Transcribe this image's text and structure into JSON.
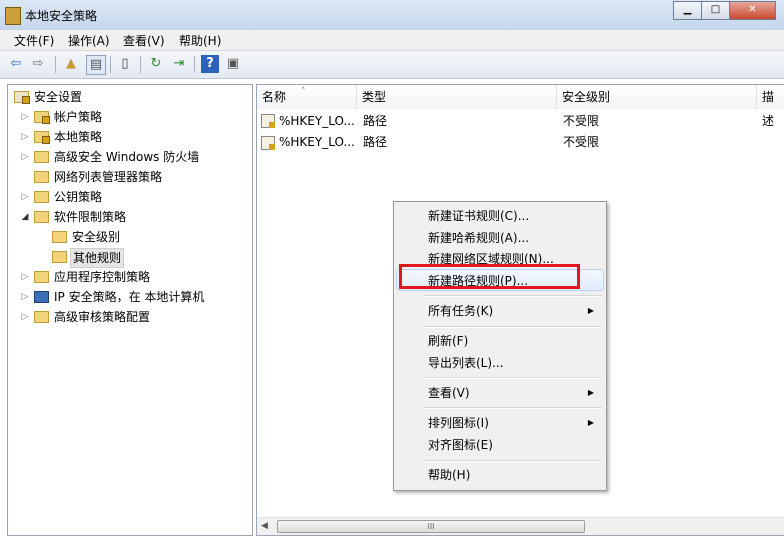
{
  "window": {
    "title": "本地安全策略",
    "minimize": "▁",
    "maximize": "□",
    "close": "✕"
  },
  "menubar": {
    "items": [
      "文件(F)",
      "操作(A)",
      "查看(V)",
      "帮助(H)"
    ]
  },
  "toolbar": {
    "icons": [
      "back-icon",
      "forward-icon",
      "up-folder-icon",
      "show-hide-tree-icon",
      "properties-icon",
      "refresh-icon",
      "export-list-icon",
      "help-icon",
      "console-icon"
    ]
  },
  "tree": {
    "root": "安全设置",
    "items": [
      "帐户策略",
      "本地策略",
      "高级安全 Windows 防火墙",
      "网络列表管理器策略",
      "公钥策略",
      "软件限制策略",
      "安全级别",
      "其他规则",
      "应用程序控制策略",
      "IP 安全策略，在 本地计算机",
      "高级审核策略配置"
    ]
  },
  "list": {
    "columns": [
      "名称",
      "类型",
      "安全级别",
      "描述"
    ],
    "rows": [
      {
        "name": "%HKEY_LO...",
        "type": "路径",
        "level": "不受限"
      },
      {
        "name": "%HKEY_LO...",
        "type": "路径",
        "level": "不受限"
      }
    ]
  },
  "scrollbar": {
    "grip": "III"
  },
  "context_menu": {
    "items": [
      "新建证书规则(C)...",
      "新建哈希规则(A)...",
      "新建网络区域规则(N)...",
      "新建路径规则(P)...",
      "所有任务(K)",
      "刷新(F)",
      "导出列表(L)...",
      "查看(V)",
      "排列图标(I)",
      "对齐图标(E)",
      "帮助(H)"
    ],
    "submenu_arrow": "▶"
  },
  "highlight_color": "#e3161e"
}
